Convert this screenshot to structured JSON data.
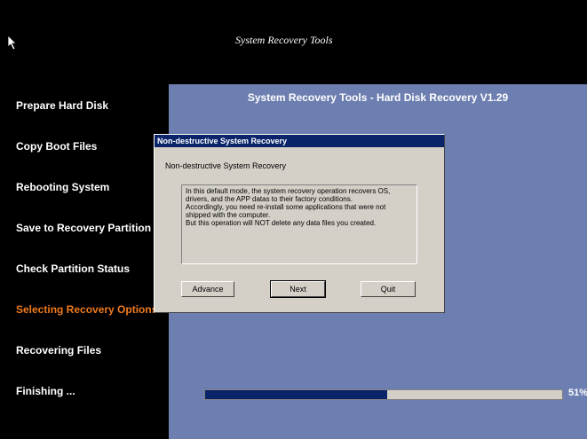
{
  "banner": {
    "title": "System Recovery Tools"
  },
  "sidebar": {
    "steps": [
      {
        "label": "Prepare Hard Disk"
      },
      {
        "label": "Copy Boot Files"
      },
      {
        "label": "Rebooting System"
      },
      {
        "label": "Save to Recovery Partition"
      },
      {
        "label": "Check Partition Status"
      },
      {
        "label": "Selecting Recovery Options",
        "active": true
      },
      {
        "label": "Recovering Files"
      },
      {
        "label": "Finishing ..."
      }
    ]
  },
  "main": {
    "title": "System Recovery Tools - Hard Disk Recovery V1.29",
    "progress": {
      "percent": 51,
      "label": "51%"
    }
  },
  "dialog": {
    "title": "Non-destructive System Recovery",
    "heading": "Non-destructive System Recovery",
    "description_lines": [
      "In this default mode,  the system recovery operation recovers OS,",
      "drivers, and the APP datas to their factory conditions.",
      "Accordingly, you need re-install some applications that were not",
      "shipped with the computer.",
      "But this operation will NOT delete any data files you created."
    ],
    "buttons": {
      "advance": "Advance",
      "next": "Next",
      "quit": "Quit"
    }
  },
  "colors": {
    "active_step": "#f07a1e",
    "main_background": "#6d7fb0",
    "titlebar": "#0a246a",
    "progress_fill": "#0a246a"
  }
}
